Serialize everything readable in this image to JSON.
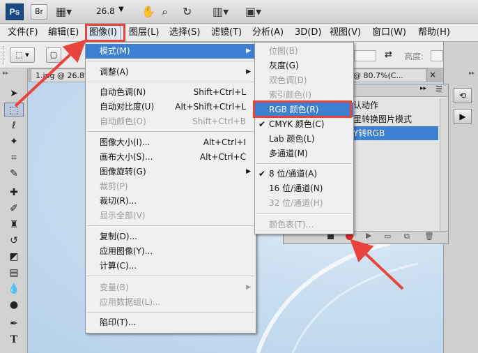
{
  "app": {
    "logo": "Ps",
    "bridge": "Br",
    "zoom": "26.8",
    "hand_icon": "hand-icon",
    "zoom_icon": "zoom-icon",
    "rotate_icon": "rotate-view-icon"
  },
  "menubar": [
    "文件(F)",
    "编辑(E)",
    "图像(I)",
    "图层(L)",
    "选择(S)",
    "滤镜(T)",
    "分析(A)",
    "3D(D)",
    "视图(V)",
    "窗口(W)",
    "帮助(H)"
  ],
  "options": {
    "height_label": "高度:"
  },
  "doc_tabs": [
    "1.jpg @ 26.8%",
    "@ 80.7%(C..."
  ],
  "actions_panel": {
    "rows": [
      "认动作",
      "里转换图片模式",
      "Y转RGB"
    ],
    "highlighted_row": 2
  },
  "image_menu": {
    "items": [
      {
        "label": "模式(M)",
        "submenu": true,
        "highlighted": true
      },
      {
        "label": "调整(A)",
        "submenu": true
      },
      {
        "label": "自动色调(N)",
        "shortcut": "Shift+Ctrl+L"
      },
      {
        "label": "自动对比度(U)",
        "shortcut": "Alt+Shift+Ctrl+L"
      },
      {
        "label": "自动颜色(O)",
        "shortcut": "Shift+Ctrl+B",
        "disabled": true
      },
      {
        "label": "图像大小(I)...",
        "shortcut": "Alt+Ctrl+I"
      },
      {
        "label": "画布大小(S)...",
        "shortcut": "Alt+Ctrl+C"
      },
      {
        "label": "图像旋转(G)",
        "submenu": true
      },
      {
        "label": "裁剪(P)",
        "disabled": true
      },
      {
        "label": "裁切(R)..."
      },
      {
        "label": "显示全部(V)",
        "disabled": true
      },
      {
        "label": "复制(D)..."
      },
      {
        "label": "应用图像(Y)..."
      },
      {
        "label": "计算(C)..."
      },
      {
        "label": "变量(B)",
        "submenu": true,
        "disabled": true
      },
      {
        "label": "应用数据组(L)...",
        "disabled": true
      },
      {
        "label": "陷印(T)..."
      }
    ]
  },
  "mode_submenu": {
    "items": [
      {
        "label": "位图(B)",
        "disabled": true
      },
      {
        "label": "灰度(G)"
      },
      {
        "label": "双色调(D)",
        "disabled": true
      },
      {
        "label": "索引颜色(I)",
        "disabled": true
      },
      {
        "label": "RGB 颜色(R)",
        "highlighted": true
      },
      {
        "label": "CMYK 颜色(C)",
        "checked": true
      },
      {
        "label": "Lab 颜色(L)"
      },
      {
        "label": "多通道(M)"
      },
      {
        "label": "8 位/通道(A)",
        "checked": true
      },
      {
        "label": "16 位/通道(N)"
      },
      {
        "label": "32 位/通道(H)",
        "disabled": true
      },
      {
        "label": "颜色表(T)...",
        "disabled": true
      }
    ]
  },
  "colors": {
    "highlight": "#3d7fd1",
    "annotation": "#e8443b",
    "record_button": "#d42a2a"
  }
}
